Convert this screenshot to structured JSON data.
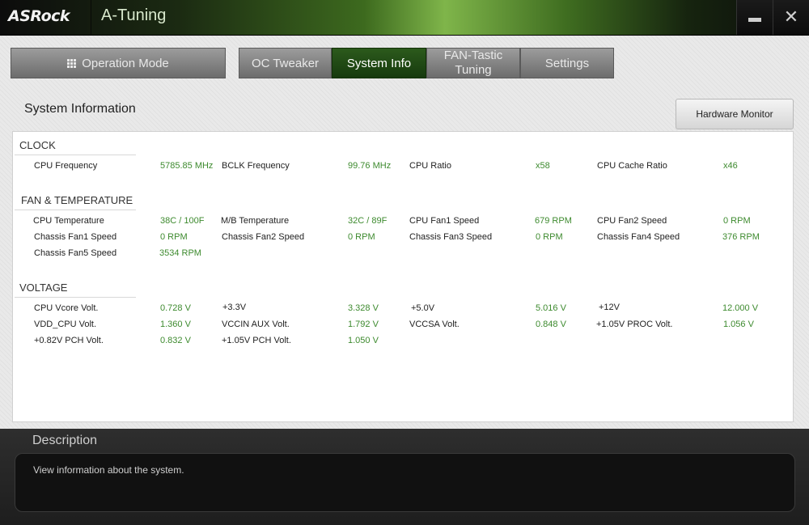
{
  "window": {
    "logo": "ASRock",
    "title": "A-Tuning",
    "minimize_label": "—",
    "close_label": "✕"
  },
  "nav": {
    "operation_mode": "Operation Mode",
    "tabs": [
      {
        "label": "OC Tweaker",
        "active": false
      },
      {
        "label": "System Info",
        "active": true
      },
      {
        "label": "FAN-Tastic Tuning",
        "active": false
      },
      {
        "label": "Settings",
        "active": false
      }
    ],
    "fan_tab_line1": "FAN-Tastic",
    "fan_tab_line2": "Tuning"
  },
  "panel": {
    "title": "System Information",
    "hardware_monitor_button": "Hardware Monitor"
  },
  "sections": {
    "clock": {
      "title": "CLOCK",
      "rows": [
        [
          {
            "label": "CPU Frequency",
            "value": "5785.85 MHz"
          },
          {
            "label": "BCLK Frequency",
            "value": "99.76 MHz"
          },
          {
            "label": "CPU Ratio",
            "value": "x58"
          },
          {
            "label": "CPU Cache Ratio",
            "value": "x46"
          }
        ]
      ]
    },
    "fan_temp": {
      "title": "FAN & TEMPERATURE",
      "rows": [
        [
          {
            "label": "CPU Temperature",
            "value": "38C / 100F"
          },
          {
            "label": "M/B Temperature",
            "value": "32C / 89F"
          },
          {
            "label": "CPU Fan1 Speed",
            "value": "679 RPM"
          },
          {
            "label": "CPU Fan2 Speed",
            "value": "0 RPM"
          }
        ],
        [
          {
            "label": "Chassis Fan1 Speed",
            "value": "0 RPM"
          },
          {
            "label": "Chassis Fan2 Speed",
            "value": "0 RPM"
          },
          {
            "label": "Chassis Fan3 Speed",
            "value": "0 RPM"
          },
          {
            "label": "Chassis Fan4 Speed",
            "value": "376 RPM"
          }
        ],
        [
          {
            "label": "Chassis Fan5 Speed",
            "value": "3534 RPM"
          }
        ]
      ]
    },
    "voltage": {
      "title": "VOLTAGE",
      "rows": [
        [
          {
            "label": "CPU Vcore Volt.",
            "value": "0.728 V"
          },
          {
            "label": "+3.3V",
            "value": "3.328 V"
          },
          {
            "label": "+5.0V",
            "value": "5.016 V"
          },
          {
            "label": "+12V",
            "value": "12.000 V"
          }
        ],
        [
          {
            "label": "VDD_CPU Volt.",
            "value": "1.360 V"
          },
          {
            "label": "VCCIN AUX Volt.",
            "value": "1.792 V"
          },
          {
            "label": "VCCSA Volt.",
            "value": "0.848 V"
          },
          {
            "label": "+1.05V PROC Volt.",
            "value": "1.056 V"
          }
        ],
        [
          {
            "label": "+0.82V PCH Volt.",
            "value": "0.832 V"
          },
          {
            "label": "+1.05V PCH Volt.",
            "value": "1.050 V"
          }
        ]
      ]
    }
  },
  "description": {
    "title": "Description",
    "text": "View information about the system."
  },
  "colors": {
    "accent_green": "#3d8a2e",
    "active_tab": "#1f4a14"
  }
}
